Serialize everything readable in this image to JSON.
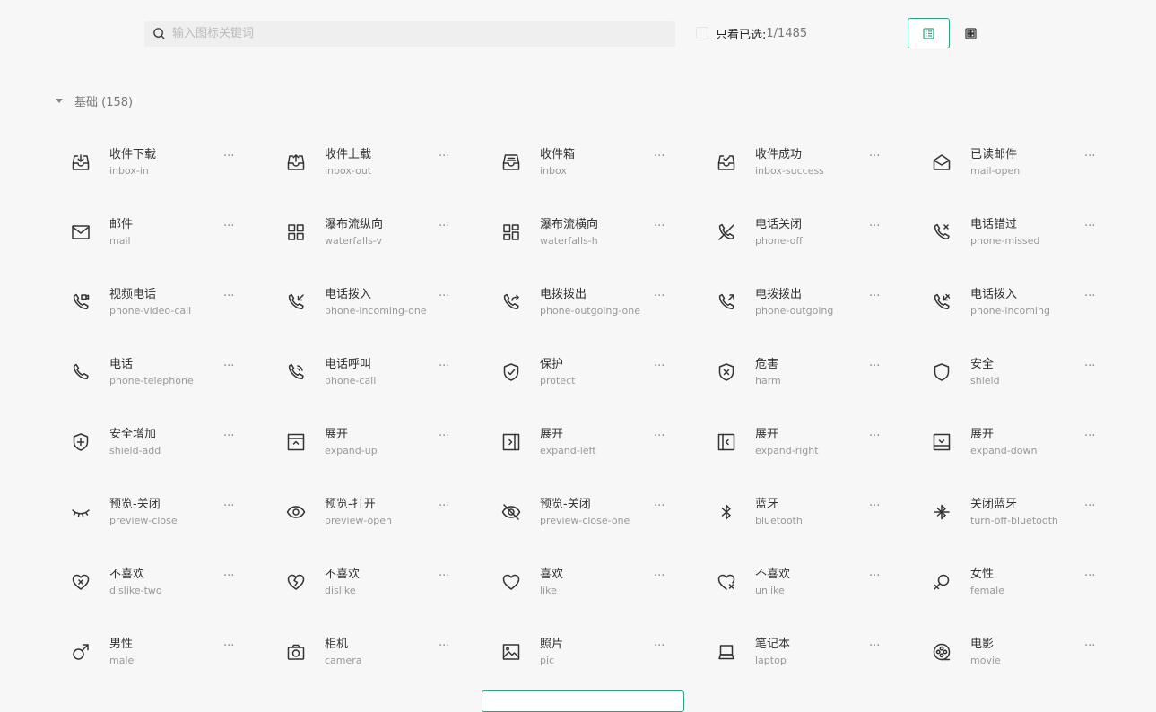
{
  "search": {
    "placeholder": "输入图标关键词",
    "value": ""
  },
  "filter": {
    "label": "只看已选:",
    "count": "1/1485",
    "checked": false
  },
  "view_toggle": {
    "options": [
      "list-view",
      "grid-view"
    ],
    "active": "list-view"
  },
  "colors": {
    "accent": "#2aa57e",
    "background": "#f7f7f7",
    "search_bg": "#efefef"
  },
  "section": {
    "title": "基础 (158)"
  },
  "more_label": "···",
  "icons": [
    {
      "cn": "收件下载",
      "en": "inbox-in",
      "icon": "inbox-in"
    },
    {
      "cn": "收件上载",
      "en": "inbox-out",
      "icon": "inbox-out"
    },
    {
      "cn": "收件箱",
      "en": "inbox",
      "icon": "inbox"
    },
    {
      "cn": "收件成功",
      "en": "inbox-success",
      "icon": "inbox-success"
    },
    {
      "cn": "已读邮件",
      "en": "mail-open",
      "icon": "mail-open"
    },
    {
      "cn": "邮件",
      "en": "mail",
      "icon": "mail"
    },
    {
      "cn": "瀑布流纵向",
      "en": "waterfalls-v",
      "icon": "waterfalls-v"
    },
    {
      "cn": "瀑布流横向",
      "en": "waterfalls-h",
      "icon": "waterfalls-h"
    },
    {
      "cn": "电话关闭",
      "en": "phone-off",
      "icon": "phone-off"
    },
    {
      "cn": "电话错过",
      "en": "phone-missed",
      "icon": "phone-missed"
    },
    {
      "cn": "视频电话",
      "en": "phone-video-call",
      "icon": "phone-video-call"
    },
    {
      "cn": "电话拨入",
      "en": "phone-incoming-one",
      "icon": "phone-incoming-one"
    },
    {
      "cn": "电拨拨出",
      "en": "phone-outgoing-one",
      "icon": "phone-outgoing-one"
    },
    {
      "cn": "电拨拨出",
      "en": "phone-outgoing",
      "icon": "phone-outgoing"
    },
    {
      "cn": "电话拨入",
      "en": "phone-incoming",
      "icon": "phone-incoming"
    },
    {
      "cn": "电话",
      "en": "phone-telephone",
      "icon": "phone-telephone"
    },
    {
      "cn": "电话呼叫",
      "en": "phone-call",
      "icon": "phone-call"
    },
    {
      "cn": "保护",
      "en": "protect",
      "icon": "protect"
    },
    {
      "cn": "危害",
      "en": "harm",
      "icon": "harm"
    },
    {
      "cn": "安全",
      "en": "shield",
      "icon": "shield"
    },
    {
      "cn": "安全增加",
      "en": "shield-add",
      "icon": "shield-add"
    },
    {
      "cn": "展开",
      "en": "expand-up",
      "icon": "expand-up"
    },
    {
      "cn": "展开",
      "en": "expand-left",
      "icon": "expand-left"
    },
    {
      "cn": "展开",
      "en": "expand-right",
      "icon": "expand-right"
    },
    {
      "cn": "展开",
      "en": "expand-down",
      "icon": "expand-down"
    },
    {
      "cn": "预览-关闭",
      "en": "preview-close",
      "icon": "preview-close"
    },
    {
      "cn": "预览-打开",
      "en": "preview-open",
      "icon": "preview-open"
    },
    {
      "cn": "预览-关闭",
      "en": "preview-close-one",
      "icon": "preview-close-one"
    },
    {
      "cn": "蓝牙",
      "en": "bluetooth",
      "icon": "bluetooth"
    },
    {
      "cn": "关闭蓝牙",
      "en": "turn-off-bluetooth",
      "icon": "turn-off-bluetooth"
    },
    {
      "cn": "不喜欢",
      "en": "dislike-two",
      "icon": "dislike-two"
    },
    {
      "cn": "不喜欢",
      "en": "dislike",
      "icon": "dislike"
    },
    {
      "cn": "喜欢",
      "en": "like",
      "icon": "like"
    },
    {
      "cn": "不喜欢",
      "en": "unlike",
      "icon": "unlike"
    },
    {
      "cn": "女性",
      "en": "female",
      "icon": "female"
    },
    {
      "cn": "男性",
      "en": "male",
      "icon": "male"
    },
    {
      "cn": "相机",
      "en": "camera",
      "icon": "camera"
    },
    {
      "cn": "照片",
      "en": "pic",
      "icon": "pic"
    },
    {
      "cn": "笔记本",
      "en": "laptop",
      "icon": "laptop"
    },
    {
      "cn": "电影",
      "en": "movie",
      "icon": "movie"
    }
  ]
}
